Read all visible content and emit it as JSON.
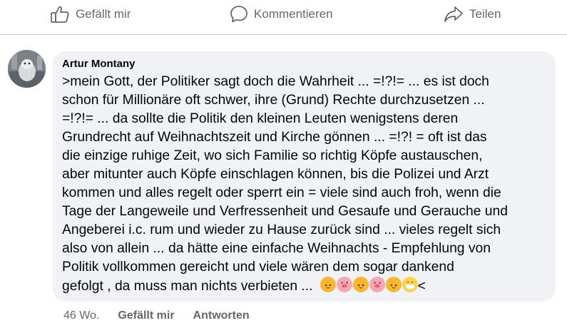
{
  "actions": {
    "like_label": "Gefällt mir",
    "comment_label": "Kommentieren",
    "share_label": "Teilen"
  },
  "comment": {
    "author": "Artur Montany",
    "lines": [
      ">mein Gott, der Politiker sagt doch die Wahrheit ... =!?!= ... es ist doch",
      "schon für Millionäre oft  schwer, ihre (Grund) Rechte durchzusetzen ...",
      "=!?!= ... da sollte die Politik den kleinen Leuten wenigstens deren",
      "Grundrecht auf Weihnachtszeit und Kirche gönnen ... =!?! = oft ist das",
      "die einzige ruhige Zeit, wo sich Familie so richtig Köpfe austauschen,",
      "aber mitunter auch Köpfe einschlagen können, bis die Polizei und Arzt",
      "kommen und alles regelt oder sperrt ein = viele sind auch froh, wenn die",
      "Tage der Langeweile und Verfressenheit und Gesaufe  und Gerauche und",
      "Angeberei  i.c. rum und wieder zu Hause zurück sind ... vieles regelt sich",
      "also von allein ... da hätte eine einfache  Weihnachts - Empfehlung von",
      "Politik vollkommen gereicht und viele wären dem sogar dankend",
      "gefolgt , da muss man nichts verbieten  ..."
    ],
    "trailing_text": "<",
    "emojis": [
      "cat-face-icon",
      "pig-face-icon",
      "cat-face-icon",
      "pig-face-icon",
      "cat-face-icon",
      "face-with-medical-mask-icon"
    ]
  },
  "meta": {
    "time": "46 Wo.",
    "like_label": "Gefällt mir",
    "reply_label": "Antworten"
  },
  "colors": {
    "bubble": "#f0f2f5",
    "secondary_text": "#65676b",
    "primary_text": "#050505"
  }
}
